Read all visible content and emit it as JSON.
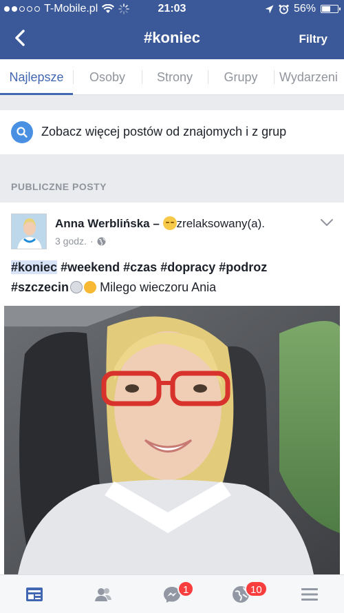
{
  "status_bar": {
    "carrier": "T-Mobile.pl",
    "time": "21:03",
    "battery_percent": "56%",
    "battery_level": 0.56
  },
  "nav": {
    "title": "#koniec",
    "filter_label": "Filtry"
  },
  "tabs": [
    {
      "label": "Najlepsze",
      "active": true
    },
    {
      "label": "Osoby"
    },
    {
      "label": "Strony"
    },
    {
      "label": "Grupy"
    },
    {
      "label": "Wydarzeni"
    }
  ],
  "suggestion": {
    "label": "Zobacz więcej postów od znajomych i z grup"
  },
  "section_label": "PUBLICZNE POSTY",
  "post": {
    "author": "Anna Werblińska",
    "separator": " – ",
    "feeling": "zrelaksowany(a).",
    "time": "3 godz.",
    "hashtags_line1": [
      "#koniec",
      "#weekend",
      "#czas",
      "#dopracy",
      "#podroz"
    ],
    "hashtag_line2": "#szczecin",
    "message": "Milego wieczoru Ania"
  },
  "bottom_nav": {
    "messages_badge": "1",
    "notifications_badge": "10"
  },
  "colors": {
    "brand": "#3b5998",
    "tab_active": "#4267b2",
    "badge": "#fa3e3e"
  }
}
